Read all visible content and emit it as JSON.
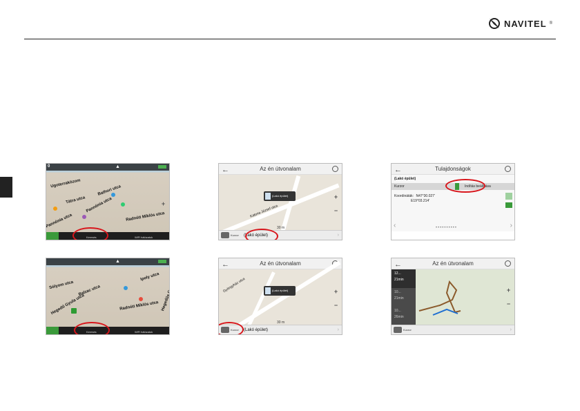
{
  "brand": {
    "name": "NAVITEL",
    "reg": "®"
  },
  "panels": {
    "map_top": {
      "speed": "0",
      "streets": [
        "Ugoterraközom",
        "Bathori utca",
        "Tátra utca",
        "Pannónia utca",
        "Radnóti Miklós utca",
        "Pannónia utca"
      ],
      "bar_left": "Keresés",
      "bar_right": "WiFi hálózatok"
    },
    "map_bottom": {
      "streets": [
        "Sólyom utca",
        "Balzac utca",
        "Hegedű Gyula utca",
        "Radnóti Miklós utca",
        "Ipoly utca",
        "Hegedűs Gyula utca"
      ],
      "bar_left": "Keresés",
      "bar_right": "WiFi hálózatok"
    },
    "route_top": {
      "title": "Az én útvonalam",
      "cursor_label": "Kurzor",
      "location": "(Lakó épület)",
      "bubble": "(Lakó épület)",
      "street": "Katona József utca",
      "scale": "30 m"
    },
    "route_bottom": {
      "title": "Az én útvonalam",
      "cursor_label": "Kurzor",
      "location": "(Lakó épület)",
      "bubble": "(Lakó épület)",
      "street": "Gyöngyház utca",
      "scale": "30 m"
    },
    "properties": {
      "title": "Tulajdonságok",
      "name": "(Lakó épület)",
      "cursor_label": "Kurzor",
      "set_start": "Indítás beállítása",
      "coords_label": "Koordináták:",
      "lat": "N47°30.027'",
      "lon": "E19°03.214'"
    },
    "route_result": {
      "title": "Az én útvonalam",
      "cursor_label": "Kurzor",
      "routes": [
        {
          "dist": "12...",
          "time": "21min"
        },
        {
          "dist": "10...",
          "time": "21min"
        },
        {
          "dist": "10...",
          "time": "26min"
        }
      ]
    }
  },
  "colors": {
    "highlight": "#d8151b",
    "accent_green": "#3a9a3a",
    "map_bg": "#e9e4da"
  }
}
